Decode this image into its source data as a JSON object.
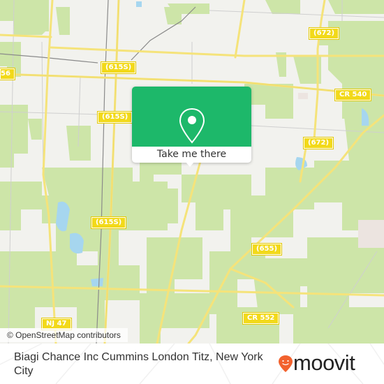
{
  "map": {
    "attribution": "© OpenStreetMap contributors",
    "colors": {
      "background": "#f2f2ee",
      "forest": "#cde5a8",
      "water": "#a6d6ef",
      "road_major": "#f5e37a",
      "road_minor": "#c8c8c8",
      "railway": "#888888",
      "shield": "#f2d91a"
    },
    "road_labels": [
      {
        "id": "r615s-a",
        "text": "(615S)"
      },
      {
        "id": "r615s-b",
        "text": "(615S)"
      },
      {
        "id": "r615s-c",
        "text": "(615S)"
      },
      {
        "id": "r672-a",
        "text": "(672)"
      },
      {
        "id": "r672-b",
        "text": "(672)"
      },
      {
        "id": "cr540",
        "text": "CR 540"
      },
      {
        "id": "r655",
        "text": "(655)"
      },
      {
        "id": "cr552",
        "text": "CR 552"
      },
      {
        "id": "nj47",
        "text": "NJ 47"
      },
      {
        "id": "edge56",
        "text": "56"
      }
    ]
  },
  "popup": {
    "icon": "location-pin-icon",
    "button_label": "Take me there",
    "accent": "#1db86a"
  },
  "footer": {
    "place_name": "Biagi Chance Inc Cummins London Titz, New York City",
    "logo_text": "moovit",
    "logo_icon": "moovit-pin-icon",
    "logo_color": "#f2622e"
  }
}
